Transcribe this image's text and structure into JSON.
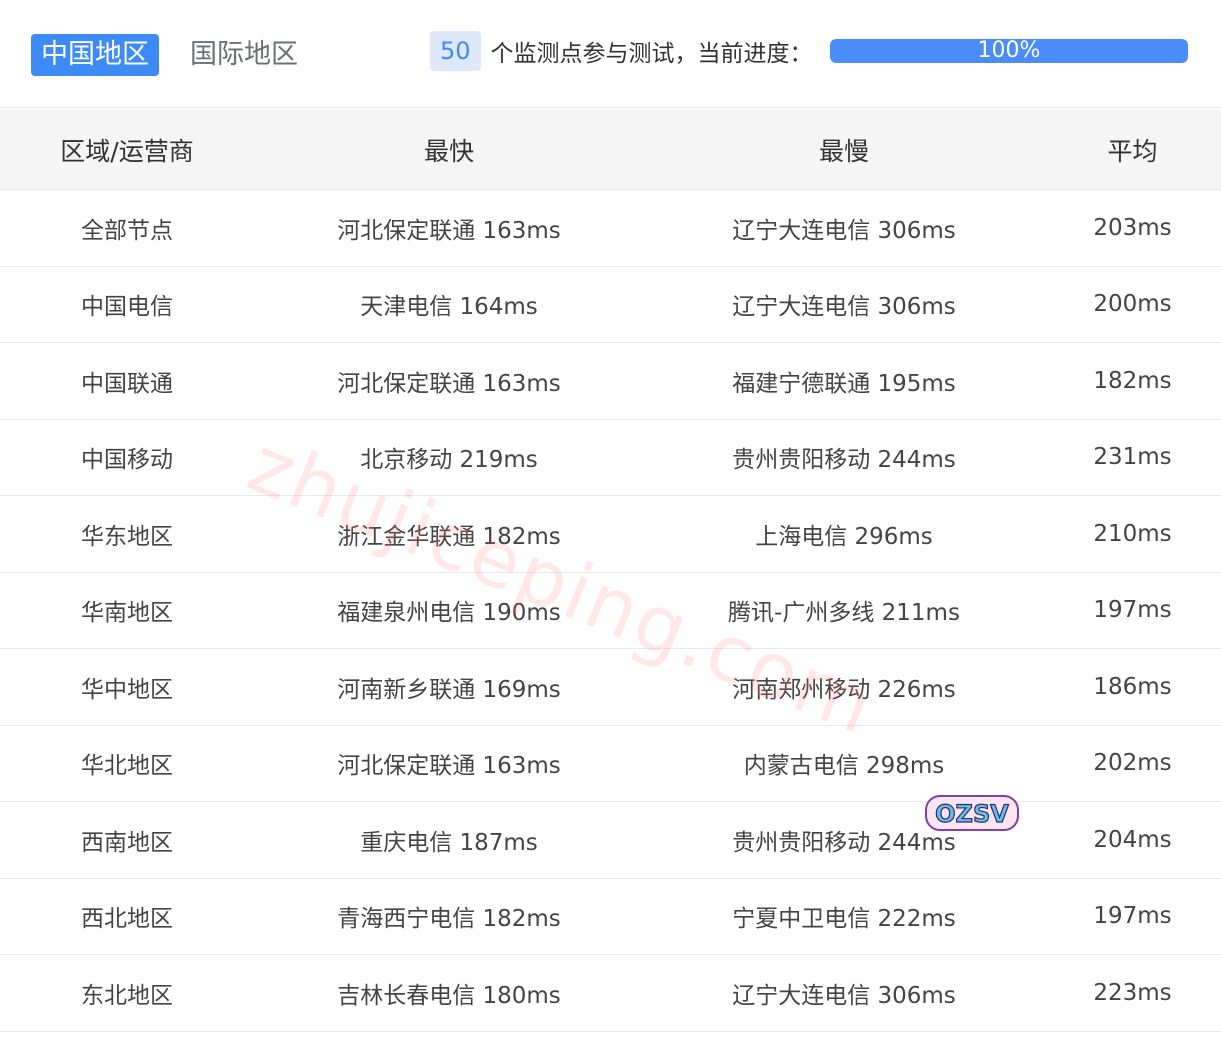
{
  "tabs": {
    "active": "中国地区",
    "inactive": "国际地区"
  },
  "progress": {
    "count": "50",
    "label": "个监测点参与测试，当前进度：",
    "percent_text": "100%",
    "percent_value": 100,
    "fill_color": "#4a8df8"
  },
  "table": {
    "headers": [
      "区域/运营商",
      "最快",
      "最慢",
      "平均"
    ],
    "rows": [
      [
        "全部节点",
        "河北保定联通 163ms",
        "辽宁大连电信 306ms",
        "203ms"
      ],
      [
        "中国电信",
        "天津电信 164ms",
        "辽宁大连电信 306ms",
        "200ms"
      ],
      [
        "中国联通",
        "河北保定联通 163ms",
        "福建宁德联通 195ms",
        "182ms"
      ],
      [
        "中国移动",
        "北京移动 219ms",
        "贵州贵阳移动 244ms",
        "231ms"
      ],
      [
        "华东地区",
        "浙江金华联通 182ms",
        "上海电信 296ms",
        "210ms"
      ],
      [
        "华南地区",
        "福建泉州电信 190ms",
        "腾讯-广州多线 211ms",
        "197ms"
      ],
      [
        "华中地区",
        "河南新乡联通 169ms",
        "河南郑州移动 226ms",
        "186ms"
      ],
      [
        "华北地区",
        "河北保定联通 163ms",
        "内蒙古电信 298ms",
        "202ms"
      ],
      [
        "西南地区",
        "重庆电信 187ms",
        "贵州贵阳移动 244ms",
        "204ms"
      ],
      [
        "西北地区",
        "青海西宁电信 182ms",
        "宁夏中卫电信 222ms",
        "197ms"
      ],
      [
        "东北地区",
        "吉林长春电信 180ms",
        "辽宁大连电信 306ms",
        "223ms"
      ]
    ]
  },
  "watermark": {
    "text": "zhujiceping.com",
    "sticker_text": "OZSV"
  },
  "colors": {
    "accent": "#3d8bf7",
    "header_bg": "#f5f5f5",
    "badge_bg": "#dde9fb"
  }
}
